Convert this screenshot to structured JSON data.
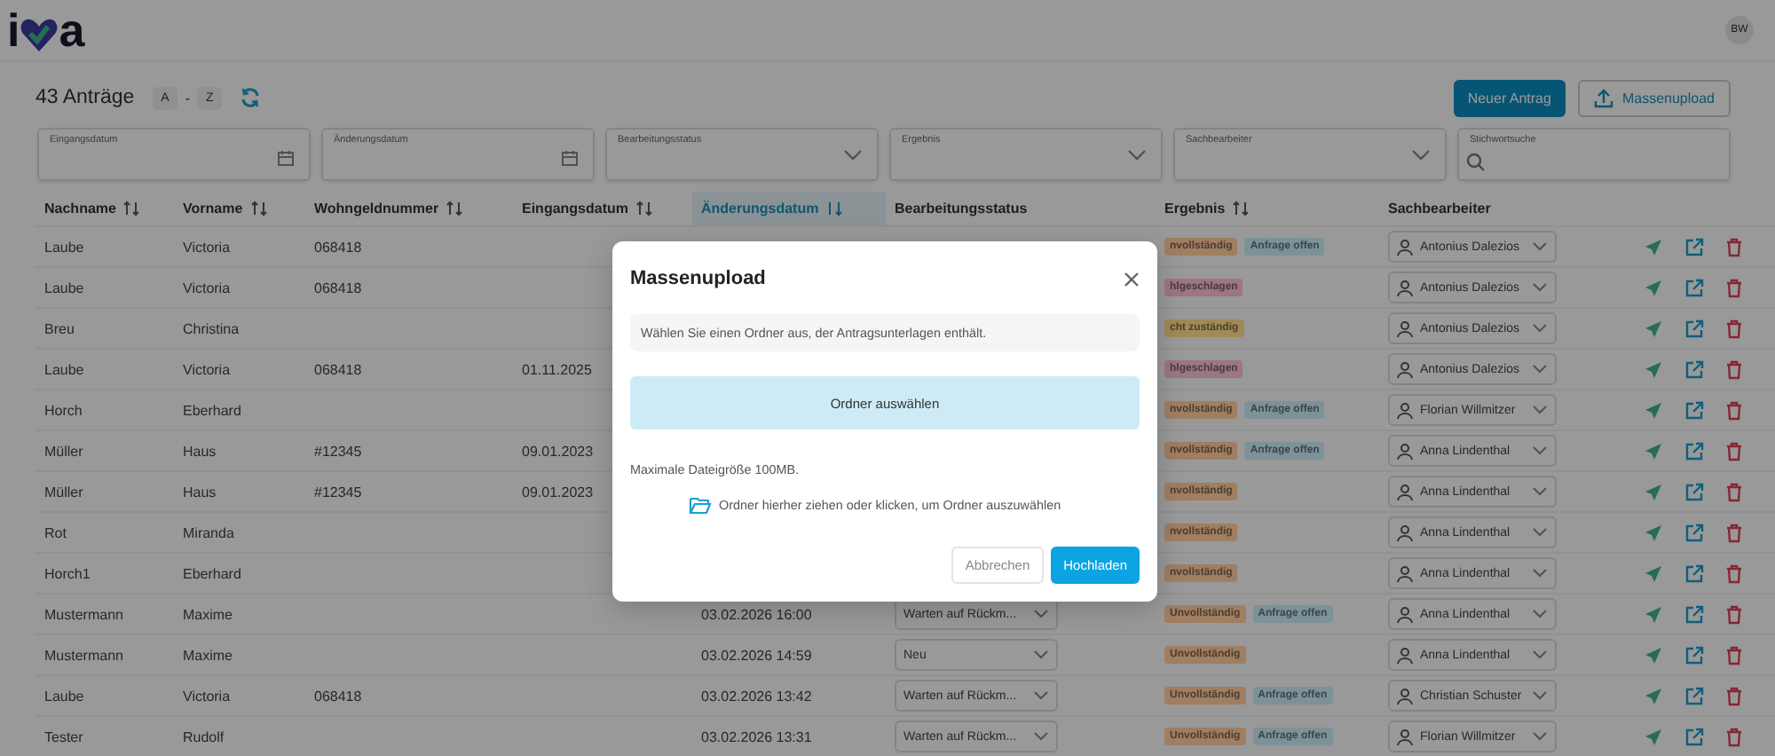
{
  "header": {
    "logo": [
      "i",
      "a"
    ],
    "avatar": "BW"
  },
  "toolbar": {
    "count": "43 Anträge",
    "sort_chips": [
      "A",
      "-",
      "Z"
    ],
    "buttons": [
      {
        "label": "Neuer Antrag",
        "kind": "primary"
      },
      {
        "label": "Massenupload",
        "kind": "upload"
      }
    ]
  },
  "filters": [
    {
      "label": "Eingangsdatum",
      "kind": "date"
    },
    {
      "label": "Änderungsdatum",
      "kind": "date"
    },
    {
      "label": "Bearbeitungsstatus",
      "kind": "select"
    },
    {
      "label": "Ergebnis",
      "kind": "select"
    },
    {
      "label": "Sachbearbeiter",
      "kind": "select"
    },
    {
      "label": "Stichwortsuche",
      "kind": "search"
    }
  ],
  "table": {
    "columns": [
      {
        "label": "Nachname",
        "sortable": true,
        "selected": false
      },
      {
        "label": "Vorname",
        "sortable": true,
        "selected": false
      },
      {
        "label": "Wohngeldnummer",
        "sortable": true,
        "selected": false
      },
      {
        "label": "Eingangsdatum",
        "sortable": true,
        "selected": false
      },
      {
        "label": "Änderungsdatum",
        "sortable": true,
        "selected": true
      },
      {
        "label": "Bearbeitungsstatus",
        "sortable": false,
        "selected": false
      },
      {
        "label": "Ergebnis",
        "sortable": true,
        "selected": false
      },
      {
        "label": "Sachbearbeiter",
        "sortable": false,
        "selected": false
      }
    ],
    "rows": [
      {
        "nachname": "Laube",
        "vorname": "Victoria",
        "wohngeldnummer": "068418",
        "tags": [
          {
            "text": "nvollständig",
            "color": "#a07e62"
          },
          {
            "text": "Anfrage offen",
            "color": "#7c9298"
          }
        ],
        "sachbearbeiter": "Antonius Dalezios"
      },
      {
        "nachname": "Laube",
        "vorname": "Victoria",
        "wohngeldnummer": "068418",
        "tags": [
          {
            "text": "hlgeschlagen",
            "color": "#9c7680"
          }
        ],
        "sachbearbeiter": "Antonius Dalezios"
      },
      {
        "nachname": "Breu",
        "vorname": "Christina",
        "tags": [
          {
            "text": "cht zuständig",
            "color": "#a08a58"
          }
        ],
        "sachbearbeiter": "Antonius Dalezios"
      },
      {
        "nachname": "Laube",
        "vorname": "Victoria",
        "wohngeldnummer": "068418",
        "eingangsdatum": "01.11.2025",
        "tags": [
          {
            "text": "hlgeschlagen",
            "color": "#9c7680"
          }
        ],
        "sachbearbeiter": "Antonius Dalezios"
      },
      {
        "nachname": "Horch",
        "vorname": "Eberhard",
        "tags": [
          {
            "text": "nvollständig",
            "color": "#a07e62"
          },
          {
            "text": "Anfrage offen",
            "color": "#7c9298"
          }
        ],
        "sachbearbeiter": "Florian Willmitzer"
      },
      {
        "nachname": "Müller",
        "vorname": "Haus",
        "wohngeldnummer": "#12345",
        "eingangsdatum": "09.01.2023",
        "tags": [
          {
            "text": "nvollständig",
            "color": "#a07e62"
          },
          {
            "text": "Anfrage offen",
            "color": "#7c9298"
          }
        ],
        "sachbearbeiter": "Anna Lindenthal"
      },
      {
        "nachname": "Müller",
        "vorname": "Haus",
        "wohngeldnummer": "#12345",
        "eingangsdatum": "09.01.2023",
        "tags": [
          {
            "text": "nvollständig",
            "color": "#a07e62"
          }
        ],
        "sachbearbeiter": "Anna Lindenthal"
      },
      {
        "nachname": "Rot",
        "vorname": "Miranda",
        "tags": [
          {
            "text": "nvollständig",
            "color": "#a07e62"
          }
        ],
        "sachbearbeiter": "Anna Lindenthal"
      },
      {
        "nachname": "Horch1",
        "vorname": "Eberhard",
        "tags": [
          {
            "text": "nvollständig",
            "color": "#a07e62"
          }
        ],
        "sachbearbeiter": "Anna Lindenthal"
      },
      {
        "nachname": "Mustermann",
        "vorname": "Maxime",
        "aenderungsdatum": "03.02.2026 16:00",
        "status": "Warten auf Rückm...",
        "tags": [
          {
            "text": "Unvollständig",
            "color": "#a07e62"
          },
          {
            "text": "Anfrage offen",
            "color": "#7c9298"
          }
        ],
        "sachbearbeiter": "Anna Lindenthal"
      },
      {
        "nachname": "Mustermann",
        "vorname": "Maxime",
        "aenderungsdatum": "03.02.2026 14:59",
        "status": "Neu",
        "tags": [
          {
            "text": "Unvollständig",
            "color": "#a07e62"
          }
        ],
        "sachbearbeiter": "Anna Lindenthal"
      },
      {
        "nachname": "Laube",
        "vorname": "Victoria",
        "wohngeldnummer": "068418",
        "aenderungsdatum": "03.02.2026 13:42",
        "status": "Warten auf Rückm...",
        "tags": [
          {
            "text": "Unvollständig",
            "color": "#a07e62"
          },
          {
            "text": "Anfrage offen",
            "color": "#7c9298"
          }
        ],
        "sachbearbeiter": "Christian Schuster"
      },
      {
        "nachname": "Tester",
        "vorname": "Rudolf",
        "aenderungsdatum": "03.02.2026 13:31",
        "status": "Warten auf Rückm...",
        "tags": [
          {
            "text": "Unvollständig",
            "color": "#a07e62"
          },
          {
            "text": "Anfrage offen",
            "color": "#7c9298"
          }
        ],
        "sachbearbeiter": "Florian Willmitzer"
      }
    ]
  },
  "modal": {
    "title": "Massenupload",
    "info": "Wählen Sie einen Ordner aus, der Antragsunterlagen enthält.",
    "select_button": "Ordner auswählen",
    "max_size": "Maximale Dateigröße 100MB.",
    "drop_hint": "Ordner hierher ziehen oder klicken, um Ordner auszuwählen",
    "buttons": [
      {
        "label": "Abbrechen",
        "kind": "secondary"
      },
      {
        "label": "Hochladen",
        "kind": "primary"
      }
    ]
  }
}
